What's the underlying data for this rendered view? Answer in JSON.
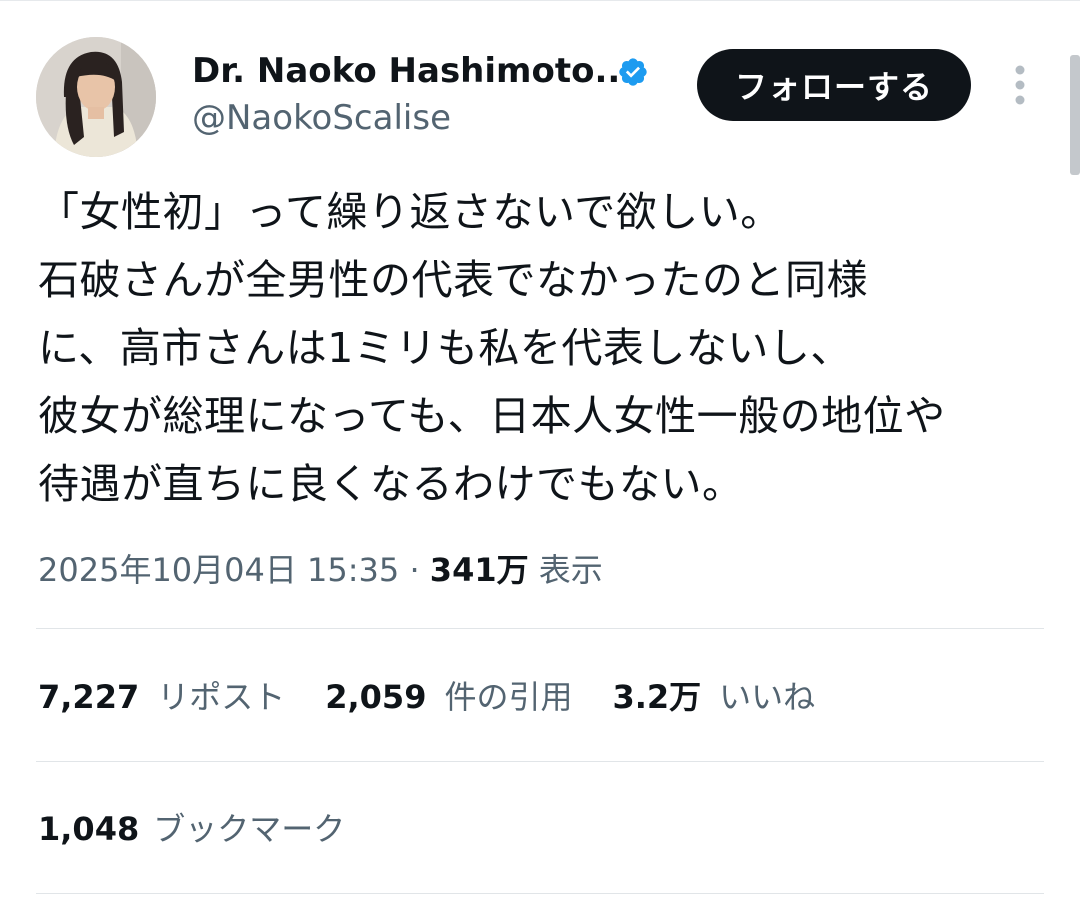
{
  "author": {
    "name": "Dr. Naoko Hashimoto...",
    "handle": "@NaokoScalise",
    "verified": true,
    "verified_color": "#1d9bf0"
  },
  "follow_button": {
    "label": "フォローする"
  },
  "tweet": {
    "lines": [
      "「女性初」って繰り返さないで欲しい。",
      "石破さんが全男性の代表でなかったのと同様",
      "に、高市さんは1ミリも私を代表しないし、",
      "彼女が総理になっても、日本人女性一般の地位や",
      "待遇が直ちに良くなるわけでもない。"
    ]
  },
  "meta": {
    "timestamp": "2025年10月04日 15:35",
    "separator": "·",
    "views": "341万",
    "views_label": "表示"
  },
  "stats": {
    "reposts": {
      "count": "7,227",
      "label": "リポスト"
    },
    "quotes": {
      "count": "2,059",
      "label": "件の引用"
    },
    "likes": {
      "count": "3.2万",
      "label": "いいね"
    }
  },
  "bookmarks": {
    "count": "1,048",
    "label": "ブックマーク"
  },
  "colors": {
    "text": "#0f1419",
    "secondary": "#536471",
    "button_bg": "#0f1419",
    "divider": "#e1e5e8"
  },
  "icons": {
    "verified": "verified-badge-icon",
    "more": "more-vertical-icon"
  }
}
